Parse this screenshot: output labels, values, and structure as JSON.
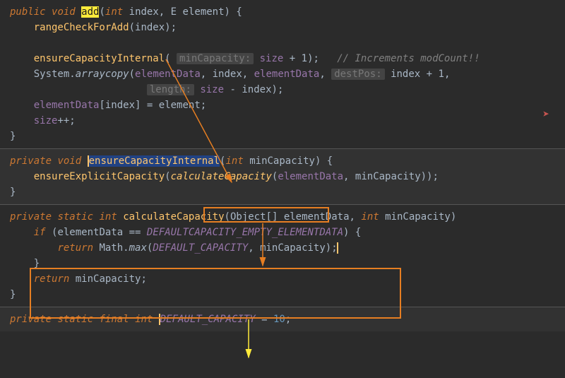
{
  "code": {
    "l1": {
      "kw_public": "public",
      "kw_void": "void",
      "method": "add",
      "p_int": "int",
      "p_index": "index",
      "p_E": "E",
      "p_element": "element"
    },
    "l2": {
      "call": "rangeCheckForAdd",
      "arg": "index"
    },
    "l3": {
      "call": "ensureCapacityInternal",
      "hint": "minCapacity:",
      "field": "size",
      "plus1": "+ 1",
      "comment": "// Increments modCount!!"
    },
    "l4": {
      "sys": "System",
      "arraycopy": "arraycopy",
      "a1": "elementData",
      "a2": "index",
      "a3": "elementData",
      "hint": "destPos:",
      "a4": "index",
      "plus1": "+ 1"
    },
    "l5": {
      "hint": "length:",
      "field": "size",
      "minus": "-",
      "var": "index"
    },
    "l6": {
      "arr": "elementData",
      "idx": "index",
      "eq": "=",
      "val": "element"
    },
    "l7": {
      "field": "size",
      "pp": "++"
    },
    "l9": {
      "kw_priv": "private",
      "kw_void": "void",
      "method": "ensureCapacityInternal",
      "p_int": "int",
      "p_min": "minCapacity"
    },
    "l10": {
      "call": "ensureExplicitCapacity",
      "inner": "calculateCapacity",
      "a1": "elementData",
      "a2": "minCapacity"
    },
    "l12": {
      "kw_priv": "private",
      "kw_static": "static",
      "kw_int": "int",
      "method": "calculateCapacity",
      "obj": "Object",
      "brackets": "[]",
      "p1": "elementData",
      "p_int": "int",
      "p2": "minCapacity"
    },
    "l13": {
      "kw_if": "if",
      "var": "elementData",
      "eq": "==",
      "const": "DEFAULTCAPACITY_EMPTY_ELEMENTDATA"
    },
    "l14": {
      "kw_ret": "return",
      "math": "Math",
      "max": "max",
      "const": "DEFAULT_CAPACITY",
      "p": "minCapacity"
    },
    "l16": {
      "kw_ret": "return",
      "var": "minCapacity"
    },
    "l18": {
      "kw_priv": "private",
      "kw_static": "static",
      "kw_final": "final",
      "kw_int": "int",
      "const": "DEFAULT_CAPACITY",
      "eq": "=",
      "val": "10"
    }
  },
  "icons": {
    "run": "➤"
  }
}
